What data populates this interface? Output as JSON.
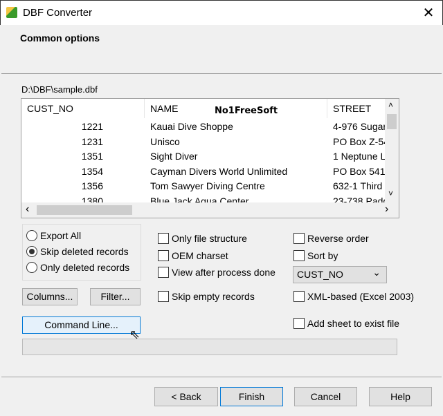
{
  "window": {
    "title": "DBF Converter",
    "close": "✕"
  },
  "header": {
    "title": "Common options"
  },
  "file_path": "D:\\DBF\\sample.dbf",
  "grid": {
    "columns": [
      "CUST_NO",
      "NAME",
      "STREET"
    ],
    "rows": [
      [
        "1221",
        "Kauai Dive Shoppe",
        "4-976 Sugar"
      ],
      [
        "1231",
        "Unisco",
        "PO Box Z-54"
      ],
      [
        "1351",
        "Sight Diver",
        "1 Neptune L"
      ],
      [
        "1354",
        "Cayman Divers World Unlimited",
        "PO Box 541"
      ],
      [
        "1356",
        "Tom Sawyer Diving Centre",
        "632-1 Third"
      ],
      [
        "1380",
        "Blue Jack Aqua Center",
        "23-738 Padd"
      ]
    ],
    "scroll_left": "‹",
    "scroll_right": "›",
    "scroll_up": "˄",
    "scroll_down": "˅"
  },
  "watermark": "No1FreeSoft",
  "export_mode": {
    "options": [
      "Export All",
      "Skip deleted records",
      "Only deleted records"
    ],
    "selected": "Skip deleted records"
  },
  "checkboxes": {
    "only_structure": {
      "label": "Only file structure",
      "checked": false
    },
    "oem_charset": {
      "label": "OEM charset",
      "checked": false
    },
    "view_after": {
      "label": "View after process done",
      "checked": false
    },
    "skip_empty": {
      "label": "Skip empty records",
      "checked": false
    },
    "reverse_order": {
      "label": "Reverse order",
      "checked": false
    },
    "sort_by": {
      "label": "Sort by",
      "checked": false
    },
    "xml_based": {
      "label": "XML-based (Excel 2003)",
      "checked": false
    },
    "add_sheet": {
      "label": "Add sheet to exist file",
      "checked": false
    }
  },
  "sort_field": {
    "value": "CUST_NO",
    "arrow": "⌄"
  },
  "buttons": {
    "columns": "Columns...",
    "filter": "Filter...",
    "command_line": "Command Line...",
    "back": "< Back",
    "finish": "Finish",
    "cancel": "Cancel",
    "help": "Help"
  },
  "progress": 0
}
